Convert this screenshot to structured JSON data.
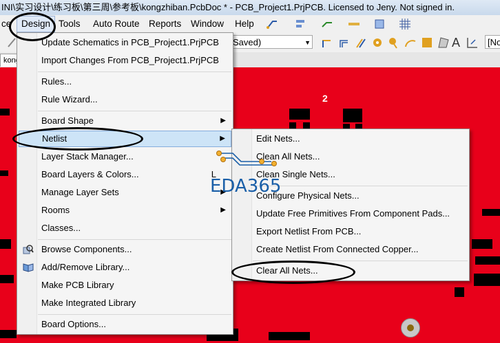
{
  "window": {
    "title": "INI\\实习设计\\练习板\\第三周\\参考板\\kongzhiban.PcbDoc * - PCB_Project1.PrjPCB. Licensed to Jeny. Not signed in."
  },
  "menubar": {
    "items": [
      "ce",
      "Design",
      "Tools",
      "Auto Route",
      "Reports",
      "Window",
      "Help"
    ]
  },
  "toolbar": {
    "combo_value": "Saved)",
    "right_combo_value": "[No"
  },
  "doc_tab": {
    "label": "kongz"
  },
  "pcb": {
    "label": "2"
  },
  "design_menu": {
    "items": [
      {
        "label": "Update Schematics in PCB_Project1.PrjPCB",
        "icon": ""
      },
      {
        "label": "Import Changes From PCB_Project1.PrjPCB",
        "icon": ""
      },
      {
        "label": "Rules...",
        "icon": ""
      },
      {
        "label": "Rule Wizard...",
        "icon": ""
      },
      {
        "label": "Board Shape",
        "icon": "",
        "submenu": true
      },
      {
        "label": "Netlist",
        "icon": "",
        "submenu": true,
        "highlighted": true
      },
      {
        "label": "Layer Stack Manager...",
        "icon": ""
      },
      {
        "label": "Board Layers & Colors...",
        "icon": "",
        "shortcut": "L"
      },
      {
        "label": "Manage Layer Sets",
        "icon": "",
        "submenu": true
      },
      {
        "label": "Rooms",
        "icon": "",
        "submenu": true
      },
      {
        "label": "Classes...",
        "icon": ""
      },
      {
        "label": "Browse Components...",
        "icon": "browse-components-icon"
      },
      {
        "label": "Add/Remove Library...",
        "icon": "library-book-icon"
      },
      {
        "label": "Make PCB Library",
        "icon": ""
      },
      {
        "label": "Make Integrated Library",
        "icon": ""
      },
      {
        "label": "Board Options...",
        "icon": ""
      }
    ]
  },
  "netlist_submenu": {
    "items": [
      {
        "label": "Edit Nets..."
      },
      {
        "label": "Clean All Nets..."
      },
      {
        "label": "Clean Single Nets..."
      },
      {
        "label": "Configure Physical Nets..."
      },
      {
        "label": "Update Free Primitives From Component Pads..."
      },
      {
        "label": "Export Netlist From PCB..."
      },
      {
        "label": "Create Netlist From Connected Copper..."
      },
      {
        "label": "Clear All Nets..."
      }
    ]
  },
  "watermark": {
    "text": "EDA365"
  },
  "colors": {
    "pcb_background": "#e8001a",
    "highlight": "#cde4f7",
    "watermark": "#1a5fa8"
  }
}
